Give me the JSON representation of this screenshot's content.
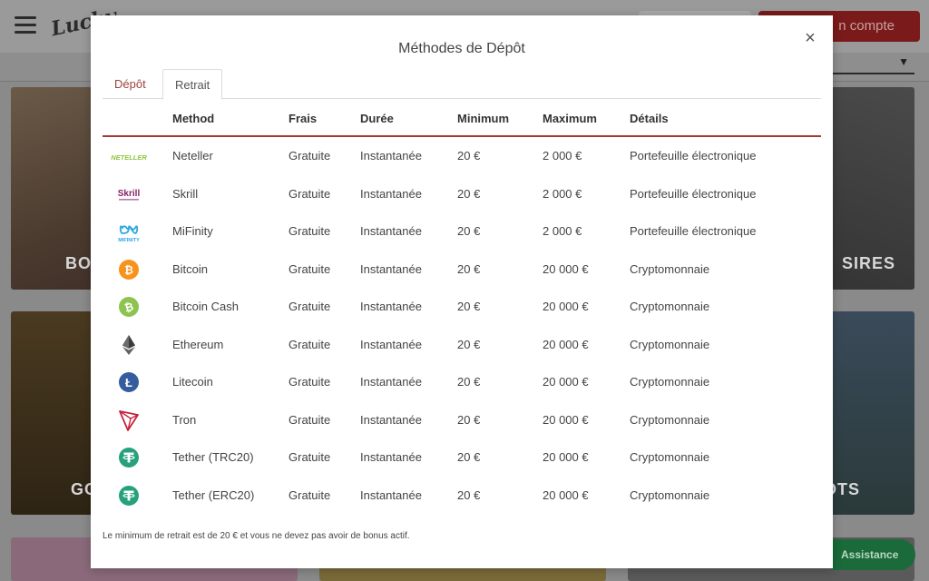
{
  "background": {
    "logo_text": "Lucky",
    "signup_label": "n compte",
    "tiles": [
      {
        "label": "BO"
      },
      {
        "label": "SIRES"
      },
      {
        "label": "GO"
      },
      {
        "label": "OTS"
      }
    ],
    "assistance_label": "Assistance"
  },
  "modal": {
    "title": "Méthodes de Dépôt",
    "close_glyph": "×",
    "tabs": [
      {
        "label": "Dépôt",
        "active": false
      },
      {
        "label": "Retrait",
        "active": true
      }
    ],
    "table": {
      "headers": {
        "method": "Method",
        "frais": "Frais",
        "duree": "Durée",
        "minimum": "Minimum",
        "maximum": "Maximum",
        "details": "Détails"
      },
      "rows": [
        {
          "icon": "neteller-icon",
          "logo_text": "NETELLER",
          "method": "Neteller",
          "frais": "Gratuite",
          "duree": "Instantanée",
          "minimum": "20 €",
          "maximum": "2 000 €",
          "details": "Portefeuille électronique"
        },
        {
          "icon": "skrill-icon",
          "logo_text": "Skrill",
          "method": "Skrill",
          "frais": "Gratuite",
          "duree": "Instantanée",
          "minimum": "20 €",
          "maximum": "2 000 €",
          "details": "Portefeuille électronique"
        },
        {
          "icon": "mifinity-icon",
          "logo_text": "MIFINITY",
          "method": "MiFinity",
          "frais": "Gratuite",
          "duree": "Instantanée",
          "minimum": "20 €",
          "maximum": "2 000 €",
          "details": "Portefeuille électronique"
        },
        {
          "icon": "bitcoin-icon",
          "method": "Bitcoin",
          "frais": "Gratuite",
          "duree": "Instantanée",
          "minimum": "20 €",
          "maximum": "20 000 €",
          "details": "Cryptomonnaie"
        },
        {
          "icon": "bitcoin-cash-icon",
          "method": "Bitcoin Cash",
          "frais": "Gratuite",
          "duree": "Instantanée",
          "minimum": "20 €",
          "maximum": "20 000 €",
          "details": "Cryptomonnaie"
        },
        {
          "icon": "ethereum-icon",
          "method": "Ethereum",
          "frais": "Gratuite",
          "duree": "Instantanée",
          "minimum": "20 €",
          "maximum": "20 000 €",
          "details": "Cryptomonnaie"
        },
        {
          "icon": "litecoin-icon",
          "method": "Litecoin",
          "frais": "Gratuite",
          "duree": "Instantanée",
          "minimum": "20 €",
          "maximum": "20 000 €",
          "details": "Cryptomonnaie"
        },
        {
          "icon": "tron-icon",
          "method": "Tron",
          "frais": "Gratuite",
          "duree": "Instantanée",
          "minimum": "20 €",
          "maximum": "20 000 €",
          "details": "Cryptomonnaie"
        },
        {
          "icon": "tether-icon",
          "method": "Tether (TRC20)",
          "frais": "Gratuite",
          "duree": "Instantanée",
          "minimum": "20 €",
          "maximum": "20 000 €",
          "details": "Cryptomonnaie"
        },
        {
          "icon": "tether-icon",
          "method": "Tether (ERC20)",
          "frais": "Gratuite",
          "duree": "Instantanée",
          "minimum": "20 €",
          "maximum": "20 000 €",
          "details": "Cryptomonnaie"
        }
      ]
    },
    "note": "Le minimum de retrait est de 20 € et vous ne devez pas avoir de bonus actif."
  },
  "colors": {
    "accent": "#a33a36",
    "neteller": "#8dc63f",
    "skrill": "#862165",
    "mifinity": "#2aa8e0",
    "bitcoin": "#f7931a",
    "bitcoin_cash": "#8dc351",
    "ethereum": "#3c3c3d",
    "litecoin": "#345d9d",
    "tron": "#c4243c",
    "tether": "#26a17b"
  }
}
